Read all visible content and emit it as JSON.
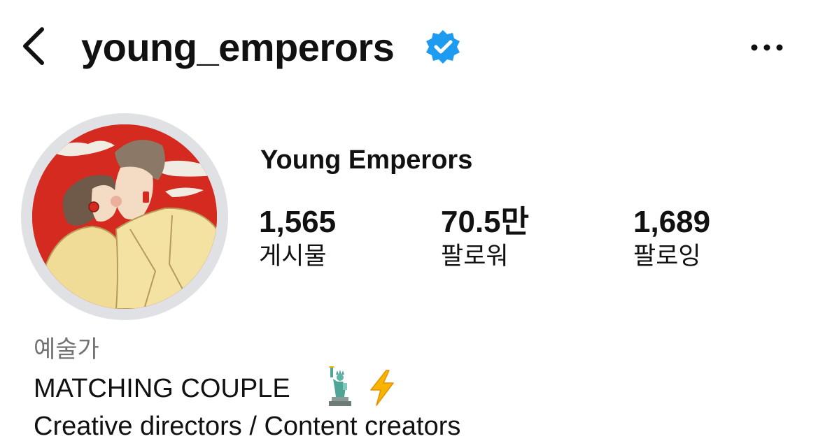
{
  "header": {
    "username": "young_emperors",
    "back_icon": "chevron-left-icon",
    "verified_icon": "verified-badge-icon",
    "more_icon": "more-horizontal-icon",
    "verified_color": "#1d9bf0"
  },
  "profile": {
    "display_name": "Young Emperors",
    "avatar_icon": "profile-avatar-illustration",
    "stats": [
      {
        "value": "1,565",
        "label": "게시물"
      },
      {
        "value": "70.5만",
        "label": "팔로워"
      },
      {
        "value": "1,689",
        "label": "팔로잉"
      }
    ]
  },
  "bio": {
    "category": "예술가",
    "line1": "MATCHING COUPLE",
    "line1_emojis": [
      "statue-of-liberty-icon",
      "lightning-bolt-icon"
    ],
    "line2": "Creative directors / Content creators"
  }
}
